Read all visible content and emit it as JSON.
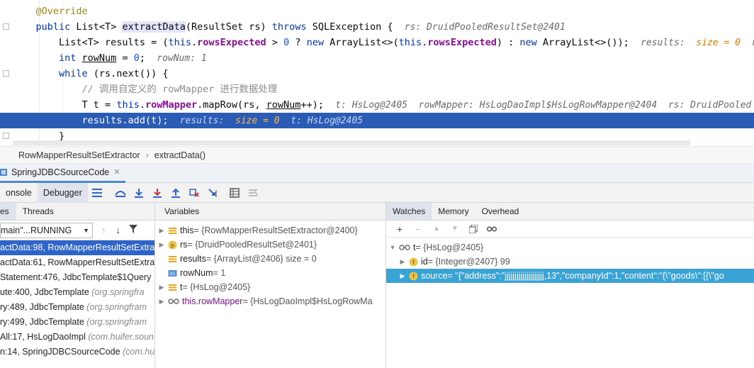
{
  "editor": {
    "lines": [
      {
        "segments": [
          [
            "ann",
            "@Override"
          ]
        ]
      },
      {
        "segments": [
          [
            "kw",
            "public "
          ],
          [
            "",
            "List<T> "
          ],
          [
            "sel",
            "extractData"
          ],
          [
            "",
            "(ResultSet rs) "
          ],
          [
            "kw",
            "throws "
          ],
          [
            "",
            "SQLException {  "
          ],
          [
            "inl",
            "rs: DruidPooledResultSet@2401"
          ]
        ]
      },
      {
        "segments": [
          [
            "",
            "    List<T> results = ("
          ],
          [
            "kw",
            "this"
          ],
          [
            "",
            "."
          ],
          [
            "fld",
            "rowsExpected"
          ],
          [
            "",
            " > "
          ],
          [
            "num",
            "0"
          ],
          [
            "",
            " ? "
          ],
          [
            "kw",
            "new "
          ],
          [
            "",
            "ArrayList<>("
          ],
          [
            "kw",
            "this"
          ],
          [
            "",
            "."
          ],
          [
            "fld",
            "rowsExpected"
          ],
          [
            "",
            ") : "
          ],
          [
            "kw",
            "new "
          ],
          [
            "",
            "ArrayList<>());  "
          ],
          [
            "inl",
            "results:  "
          ],
          [
            "inl-size",
            "size = 0"
          ],
          [
            "inl",
            "  r"
          ]
        ]
      },
      {
        "segments": [
          [
            "kw",
            "    int "
          ],
          [
            "under",
            "rowNum"
          ],
          [
            "",
            " = "
          ],
          [
            "num",
            "0"
          ],
          [
            "",
            ";  "
          ],
          [
            "inl",
            "rowNum: 1"
          ]
        ]
      },
      {
        "segments": [
          [
            "kw",
            "    while "
          ],
          [
            "",
            "(rs.next()) {"
          ]
        ]
      },
      {
        "segments": [
          [
            "cmt",
            "        // 调用自定义的 rowMapper 进行数据处理"
          ]
        ]
      },
      {
        "segments": [
          [
            "",
            "        T t = "
          ],
          [
            "kw",
            "this"
          ],
          [
            "",
            "."
          ],
          [
            "fld",
            "rowMapper"
          ],
          [
            "",
            ".mapRow(rs, "
          ],
          [
            "under",
            "rowNum"
          ],
          [
            "",
            "++);  "
          ],
          [
            "inl",
            "t: HsLog@2405  rowMapper: HsLogDaoImpl$HsLogRowMapper@2404  rs: DruidPooled"
          ]
        ]
      },
      {
        "segments": [
          [
            "",
            "        results.add(t);  "
          ],
          [
            "inl",
            "results:  "
          ],
          [
            "inl-size",
            "size = 0"
          ],
          [
            "inl",
            "  t: HsLog@2405"
          ]
        ],
        "highlight": true
      },
      {
        "segments": [
          [
            "",
            "    }"
          ]
        ]
      }
    ]
  },
  "breadcrumb": {
    "items": [
      "RowMapperResultSetExtractor",
      "extractData()"
    ]
  },
  "run_tab": {
    "label": "SpringJDBCSourceCode"
  },
  "debugger_tabs": {
    "console": "onsole",
    "debugger": "Debugger"
  },
  "frames_panel": {
    "tabs": [
      "es",
      "Threads"
    ],
    "thread_select": "main\"...RUNNING",
    "rows": [
      {
        "text": "actData:98, RowMapperResultSetExtra",
        "pkg": "",
        "selected": true
      },
      {
        "text": "actData:61, RowMapperResultSetExtra",
        "pkg": ""
      },
      {
        "text": "Statement:476, JdbcTemplate$1Query",
        "pkg": ""
      },
      {
        "text": "ute:400, JdbcTemplate ",
        "pkg": "(org.springfra"
      },
      {
        "text": "ry:489, JdbcTemplate ",
        "pkg": "(org.springfram"
      },
      {
        "text": "ry:499, JdbcTemplate ",
        "pkg": "(org.springfram"
      },
      {
        "text": "All:17, HsLogDaoImpl ",
        "pkg": "(com.huifer.soun"
      },
      {
        "text": "n:14, SpringJDBCSourceCode ",
        "pkg": "(com.hui"
      }
    ]
  },
  "variables_panel": {
    "title": "Variables",
    "rows": [
      {
        "name": "this",
        "value": " = {RowMapperResultSetExtractor@2400}",
        "icon": "field",
        "expand": true
      },
      {
        "name": "rs",
        "value": " = {DruidPooledResultSet@2401}",
        "icon": "param",
        "expand": true
      },
      {
        "name": "results",
        "value": " = {ArrayList@2406}  size = 0",
        "icon": "field",
        "expand": false
      },
      {
        "name": "rowNum",
        "value": " = 1",
        "icon": "int",
        "expand": false
      },
      {
        "name": "t",
        "value": " = {HsLog@2405}",
        "icon": "field",
        "expand": true
      },
      {
        "name": "this.rowMapper",
        "value": " = {HsLogDaoImpl$HsLogRowMa",
        "icon": "watch",
        "expand": true,
        "purple": true
      }
    ]
  },
  "watches_panel": {
    "tabs": [
      "Watches",
      "Memory",
      "Overhead"
    ],
    "rows": [
      {
        "name": "t",
        "value": " = {HsLog@2405}",
        "level": 0,
        "icon": "watch",
        "expanded": true
      },
      {
        "name": "id",
        "value": " = {Integer@2407} 99",
        "level": 1,
        "icon": "f"
      },
      {
        "name": "source",
        "value": " = \"{\"address\":\"jjjjjjjjjjjjjjjjjjjj,13\",\"companyId\":1,\"content\":\"{\\\"goods\\\":[{\\\"go",
        "level": 1,
        "icon": "f",
        "selected": true
      }
    ]
  },
  "colors": {
    "accent": "#2f65ca",
    "highlight_line": "#2a5bb5",
    "watch_selected": "#3aa3d6"
  }
}
